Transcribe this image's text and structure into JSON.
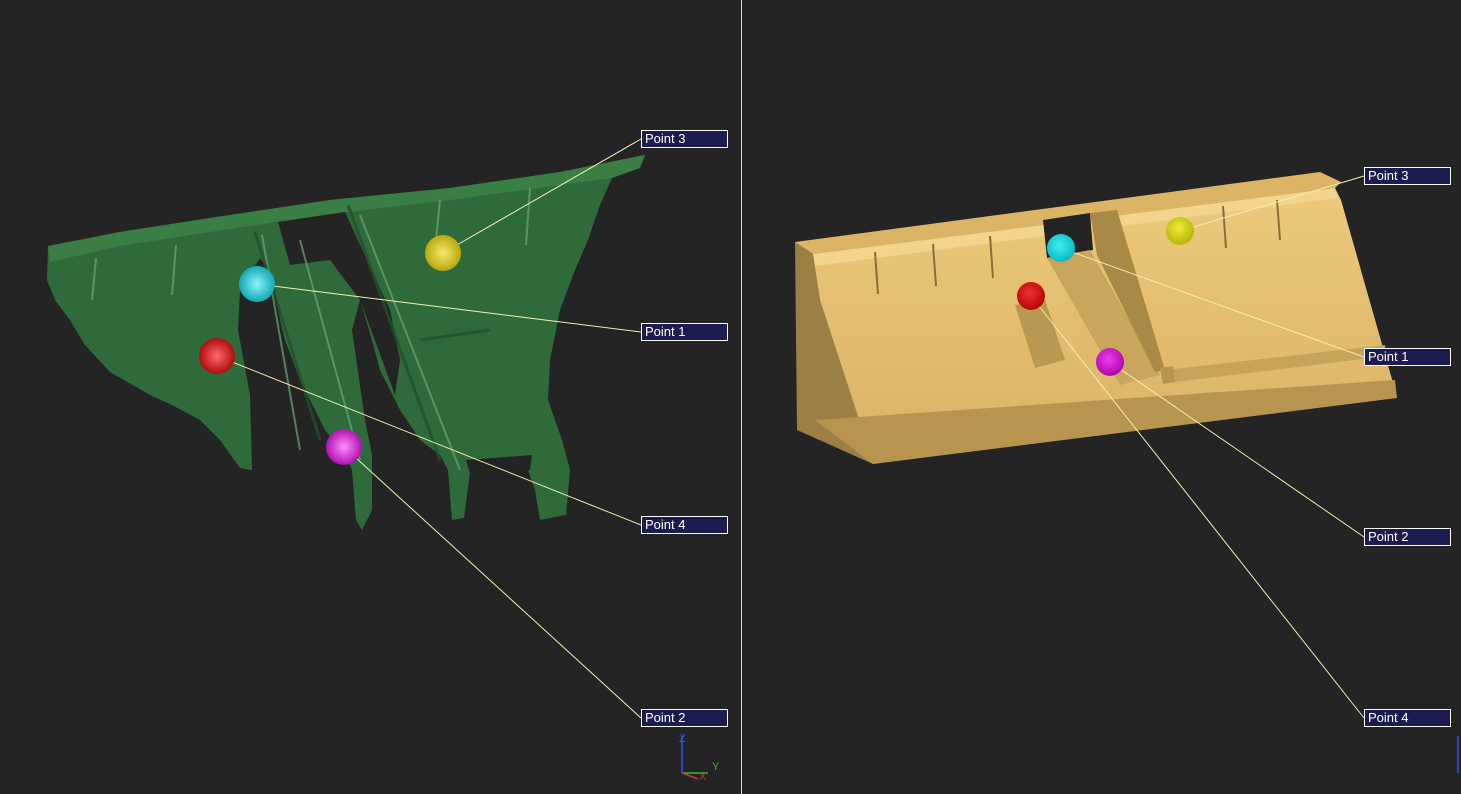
{
  "left_view": {
    "model": "scan-mesh",
    "model_color": "#2f6b3a",
    "labels": [
      {
        "id": "p3",
        "text": "Point 3",
        "color": "#d4c419"
      },
      {
        "id": "p1",
        "text": "Point 1",
        "color": "#1fc8d4"
      },
      {
        "id": "p4",
        "text": "Point 4",
        "color": "#d91414"
      },
      {
        "id": "p2",
        "text": "Point 2",
        "color": "#d41bd4"
      }
    ],
    "axis": {
      "y": "Y",
      "x": "X",
      "z": "Z"
    }
  },
  "right_view": {
    "model": "cad-model",
    "model_color": "#e2bd6f",
    "labels": [
      {
        "id": "p3",
        "text": "Point 3",
        "color": "#d4c419"
      },
      {
        "id": "p1",
        "text": "Point 1",
        "color": "#1fc8d4"
      },
      {
        "id": "p2",
        "text": "Point 2",
        "color": "#d41bd4"
      },
      {
        "id": "p4",
        "text": "Point 4",
        "color": "#d91414"
      }
    ]
  },
  "leader_line_color": "#f2eeb0",
  "label_background": "#1c1c50"
}
